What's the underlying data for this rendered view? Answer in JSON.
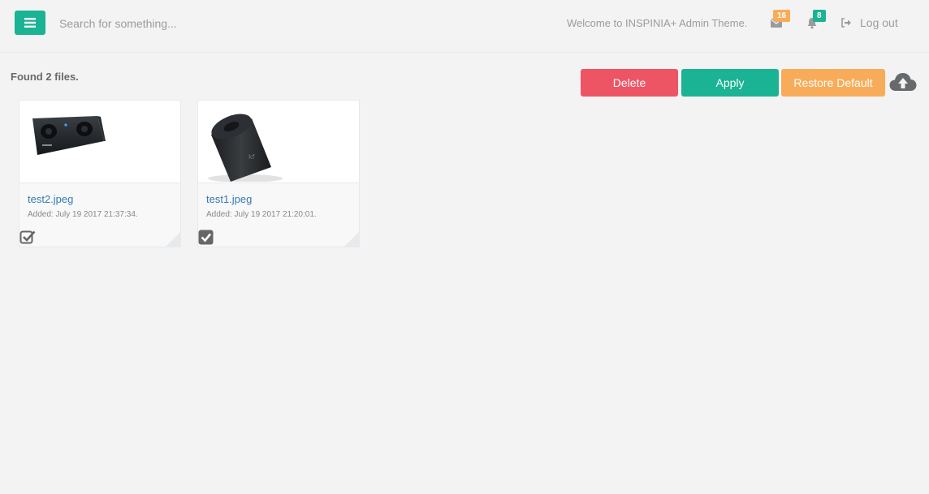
{
  "header": {
    "search_placeholder": "Search for something...",
    "welcome_text": "Welcome to INSPINIA+ Admin Theme.",
    "mail_count": "16",
    "alerts_count": "8",
    "logout_label": "Log out"
  },
  "content": {
    "found_text": "Found 2 files.",
    "delete_label": "Delete",
    "apply_label": "Apply",
    "restore_label": "Restore Default"
  },
  "files": [
    {
      "name": "test2.jpeg",
      "added": "Added: July 19 2017 21:37:34.",
      "checked": false
    },
    {
      "name": "test1.jpeg",
      "added": "Added: July 19 2017 21:20:01.",
      "checked": true
    }
  ],
  "colors": {
    "primary": "#1ab394",
    "danger": "#ed5565",
    "warning": "#f8ac59",
    "link": "#337ab7"
  },
  "icons": [
    "menu-icon",
    "envelope-icon",
    "bell-icon",
    "sign-out-icon",
    "cloud-upload-icon",
    "checkbox-icon"
  ]
}
